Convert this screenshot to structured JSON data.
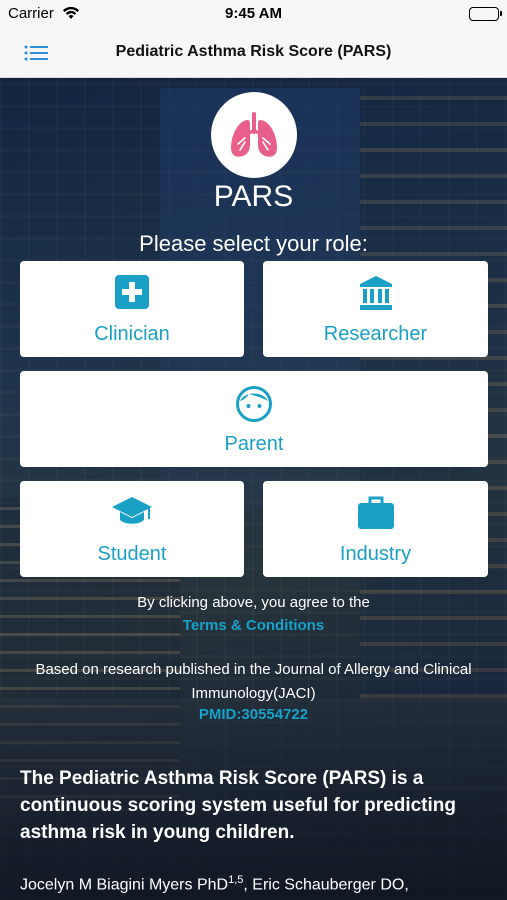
{
  "status_bar": {
    "carrier": "Carrier",
    "time": "9:45 AM"
  },
  "nav": {
    "title": "Pediatric Asthma Risk Score (PARS)",
    "menu_icon": "hamburger-list-icon"
  },
  "header": {
    "logo_icon": "lungs-icon",
    "app_name": "PARS",
    "prompt": "Please select your role:"
  },
  "roles": [
    {
      "label": "Clinician",
      "icon": "medical-cross-icon"
    },
    {
      "label": "Researcher",
      "icon": "institution-icon"
    },
    {
      "label": "Parent",
      "icon": "child-face-icon"
    },
    {
      "label": "Student",
      "icon": "graduation-cap-icon"
    },
    {
      "label": "Industry",
      "icon": "briefcase-icon"
    }
  ],
  "agreement": {
    "text": "By clicking above, you agree to the",
    "link": "Terms & Conditions"
  },
  "research": {
    "text": "Based on research published in the Journal of Allergy and Clinical Immunology(JACI)",
    "pmid": "PMID:30554722"
  },
  "description": "The Pediatric Asthma Risk Score (PARS) is a continuous scoring system useful for predicting asthma risk in young children.",
  "authors": {
    "author1_name": "Jocelyn M Biagini Myers PhD",
    "author1_sup": "1,5",
    "separator": ", ",
    "author2_name": "Eric Schauberger DO,"
  },
  "colors": {
    "accent": "#1aa0c4",
    "card_bg": "#ffffff",
    "lungs": "#e8608a"
  }
}
